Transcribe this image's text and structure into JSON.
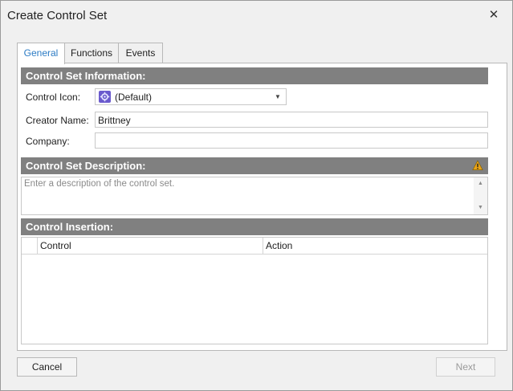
{
  "window": {
    "title": "Create Control Set",
    "close_glyph": "✕"
  },
  "tabs": [
    {
      "label": "General",
      "active": true
    },
    {
      "label": "Functions",
      "active": false
    },
    {
      "label": "Events",
      "active": false
    }
  ],
  "sections": {
    "info_header": "Control Set Information:",
    "description_header": "Control Set Description:",
    "insertion_header": "Control Insertion:"
  },
  "fields": {
    "control_icon_label": "Control Icon:",
    "control_icon_value": "(Default)",
    "control_icon_icon": "gear-icon",
    "creator_name_label": "Creator Name:",
    "creator_name_value": "Brittney",
    "company_label": "Company:",
    "company_value": ""
  },
  "description": {
    "placeholder": "Enter a description of the control set.",
    "warning_icon": "warning-icon"
  },
  "grid": {
    "columns": [
      "Control",
      "Action"
    ],
    "rows": []
  },
  "buttons": {
    "cancel": "Cancel",
    "next": "Next"
  },
  "colors": {
    "section_header_bg": "#808080",
    "active_tab_text": "#2b7bc4",
    "warning": "#e8a317"
  }
}
